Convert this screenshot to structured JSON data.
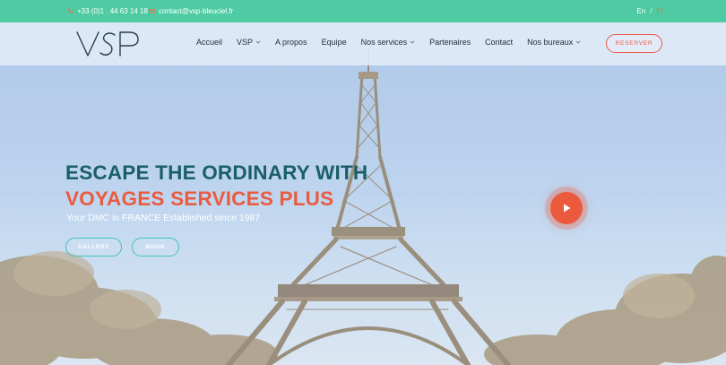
{
  "topbar": {
    "phone": "+33 (0)1 . 44 63 14 18",
    "email": "contact@vsp-bleuciel.fr",
    "lang_en": "En",
    "lang_sep": "/",
    "lang_fr": "Fr"
  },
  "nav": {
    "items": [
      {
        "label": "Accueil",
        "dropdown": false
      },
      {
        "label": "VSP",
        "dropdown": true
      },
      {
        "label": "A propos",
        "dropdown": false
      },
      {
        "label": "Equipe",
        "dropdown": false
      },
      {
        "label": "Nos services",
        "dropdown": true
      },
      {
        "label": "Partenaires",
        "dropdown": false
      },
      {
        "label": "Contact",
        "dropdown": false
      },
      {
        "label": "Nos bureaux",
        "dropdown": true
      }
    ],
    "reserve_label": "RESERVER"
  },
  "hero": {
    "headline_line1": "ESCAPE THE ORDINARY WITH",
    "headline_line2": "VOYAGES SERVICES PLUS",
    "tagline": "Your DMC in FRANCE Established since 1987",
    "gallery_label": "GALLERY",
    "book_label": "BOOK"
  },
  "colors": {
    "topbar": "#4ecba3",
    "headline_teal": "#1a5e68",
    "headline_orange": "#ea5b3f",
    "reserve_red": "#e8594b",
    "pill_border": "#3cc3c2",
    "play_button": "#ec5a3e"
  },
  "icons": {
    "phone": "phone-icon",
    "email": "email-icon",
    "play": "play-icon",
    "dropdown": "chevron-down-icon"
  }
}
